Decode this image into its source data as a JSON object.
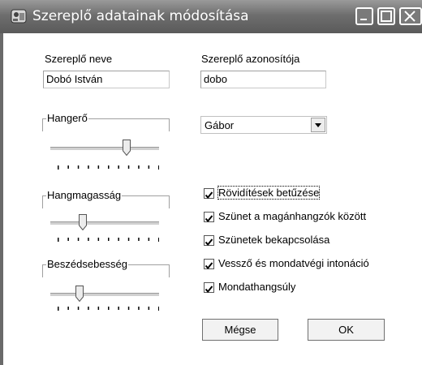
{
  "window": {
    "title": "Szereplő adatainak módosítása"
  },
  "fields": {
    "name_label": "Szereplő neve",
    "name_value": "Dobó István",
    "id_label": "Szereplő azonosítója",
    "id_value": "dobo"
  },
  "sliders": [
    {
      "label": "Hangerő",
      "level": 0.7
    },
    {
      "label": "Hangmagasság",
      "level": 0.3
    },
    {
      "label": "Beszédsebesség",
      "level": 0.27
    }
  ],
  "voice": {
    "selected": "Gábor"
  },
  "options": [
    {
      "label": "Rövidítések betűzése",
      "checked": true
    },
    {
      "label": "Szünet a magánhangzók között",
      "checked": true
    },
    {
      "label": "Szünetek bekapcsolása",
      "checked": true
    },
    {
      "label": "Vessző és mondatvégi intonáció",
      "checked": true
    },
    {
      "label": "Mondathangsúly",
      "checked": true
    }
  ],
  "buttons": {
    "cancel": "Mégse",
    "ok": "OK"
  },
  "icons": {
    "app": "speaker-app-icon",
    "minimize": "minimize-icon",
    "maximize": "maximize-icon",
    "close": "close-icon",
    "dropdown": "chevron-down-icon",
    "check": "checkmark-icon"
  }
}
